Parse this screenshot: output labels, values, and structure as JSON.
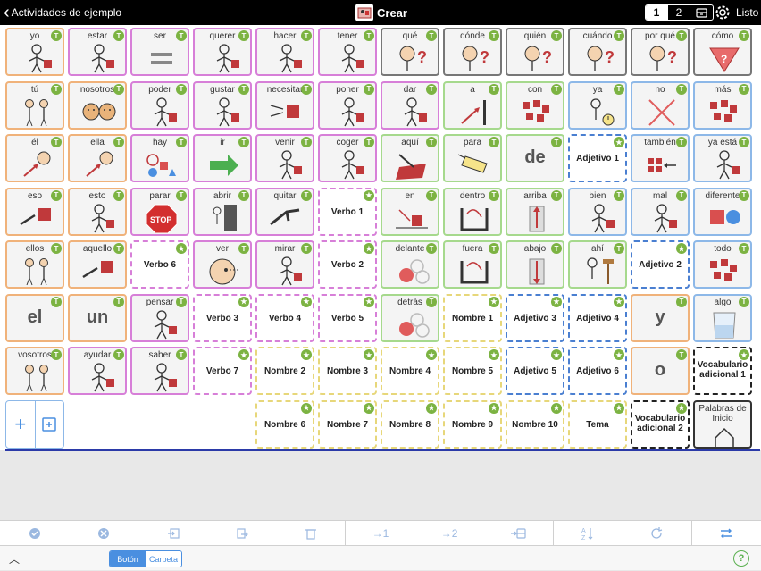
{
  "header": {
    "back_label": "Actividades de ejemplo",
    "title": "Crear",
    "pages": [
      "1",
      "2"
    ],
    "done_label": "Listo"
  },
  "cells": [
    {
      "r": 0,
      "c": 0,
      "label": "yo",
      "color": "orange",
      "icon": "person-icon"
    },
    {
      "r": 0,
      "c": 1,
      "label": "estar",
      "color": "purple",
      "icon": "person-icon"
    },
    {
      "r": 0,
      "c": 2,
      "label": "ser",
      "color": "purple",
      "icon": "equals-icon"
    },
    {
      "r": 0,
      "c": 3,
      "label": "querer",
      "color": "purple",
      "icon": "person-icon"
    },
    {
      "r": 0,
      "c": 4,
      "label": "hacer",
      "color": "purple",
      "icon": "person-icon"
    },
    {
      "r": 0,
      "c": 5,
      "label": "tener",
      "color": "purple",
      "icon": "person-icon"
    },
    {
      "r": 0,
      "c": 6,
      "label": "qué",
      "color": "gray",
      "icon": "question-icon"
    },
    {
      "r": 0,
      "c": 7,
      "label": "dónde",
      "color": "gray",
      "icon": "question-icon"
    },
    {
      "r": 0,
      "c": 8,
      "label": "quién",
      "color": "gray",
      "icon": "question-icon"
    },
    {
      "r": 0,
      "c": 9,
      "label": "cuándo",
      "color": "gray",
      "icon": "question-icon"
    },
    {
      "r": 0,
      "c": 10,
      "label": "por qué",
      "color": "gray",
      "icon": "question-icon"
    },
    {
      "r": 0,
      "c": 11,
      "label": "cómo",
      "color": "gray",
      "icon": "triangle-question-icon"
    },
    {
      "r": 1,
      "c": 0,
      "label": "tú",
      "color": "orange",
      "icon": "people-icon"
    },
    {
      "r": 1,
      "c": 1,
      "label": "nosotros",
      "color": "orange",
      "icon": "faces-icon"
    },
    {
      "r": 1,
      "c": 2,
      "label": "poder",
      "color": "purple",
      "icon": "person-icon"
    },
    {
      "r": 1,
      "c": 3,
      "label": "gustar",
      "color": "purple",
      "icon": "person-icon"
    },
    {
      "r": 1,
      "c": 4,
      "label": "necesitar",
      "color": "purple",
      "icon": "hands-box-icon"
    },
    {
      "r": 1,
      "c": 5,
      "label": "poner",
      "color": "purple",
      "icon": "person-icon"
    },
    {
      "r": 1,
      "c": 6,
      "label": "dar",
      "color": "purple",
      "icon": "person-icon"
    },
    {
      "r": 1,
      "c": 7,
      "label": "a",
      "color": "green",
      "icon": "arrow-icon"
    },
    {
      "r": 1,
      "c": 8,
      "label": "con",
      "color": "green",
      "icon": "boxes-icon"
    },
    {
      "r": 1,
      "c": 9,
      "label": "ya",
      "color": "blue",
      "icon": "person-clock-icon"
    },
    {
      "r": 1,
      "c": 10,
      "label": "no",
      "color": "blue",
      "icon": "x-icon"
    },
    {
      "r": 1,
      "c": 11,
      "label": "más",
      "color": "blue",
      "icon": "boxes-icon"
    },
    {
      "r": 2,
      "c": 0,
      "label": "él",
      "color": "orange",
      "icon": "face-arrow-icon"
    },
    {
      "r": 2,
      "c": 1,
      "label": "ella",
      "color": "orange",
      "icon": "face-arrow-icon"
    },
    {
      "r": 2,
      "c": 2,
      "label": "hay",
      "color": "purple",
      "icon": "shapes-icon"
    },
    {
      "r": 2,
      "c": 3,
      "label": "ir",
      "color": "purple",
      "icon": "green-arrow-icon"
    },
    {
      "r": 2,
      "c": 4,
      "label": "venir",
      "color": "purple",
      "icon": "person-icon"
    },
    {
      "r": 2,
      "c": 5,
      "label": "coger",
      "color": "purple",
      "icon": "person-icon"
    },
    {
      "r": 2,
      "c": 6,
      "label": "aquí",
      "color": "green",
      "icon": "point-here-icon"
    },
    {
      "r": 2,
      "c": 7,
      "label": "para",
      "color": "green",
      "icon": "tag-icon"
    },
    {
      "r": 2,
      "c": 8,
      "label": "de",
      "color": "green",
      "type": "big"
    },
    {
      "r": 2,
      "c": 9,
      "label": "Adjetivo 1",
      "color": "blueph",
      "type": "ph"
    },
    {
      "r": 2,
      "c": 10,
      "label": "también",
      "color": "blue",
      "icon": "boxes-arrow-icon"
    },
    {
      "r": 2,
      "c": 11,
      "label": "ya está",
      "color": "blue",
      "icon": "person-icon"
    },
    {
      "r": 3,
      "c": 0,
      "label": "eso",
      "color": "orange",
      "icon": "point-box-icon"
    },
    {
      "r": 3,
      "c": 1,
      "label": "esto",
      "color": "orange",
      "icon": "person-icon"
    },
    {
      "r": 3,
      "c": 2,
      "label": "parar",
      "color": "purple",
      "icon": "stop-icon"
    },
    {
      "r": 3,
      "c": 3,
      "label": "abrir",
      "color": "purple",
      "icon": "door-icon"
    },
    {
      "r": 3,
      "c": 4,
      "label": "quitar",
      "color": "purple",
      "icon": "hand-icon"
    },
    {
      "r": 3,
      "c": 5,
      "label": "Verbo 1",
      "color": "purpleph",
      "type": "ph"
    },
    {
      "r": 3,
      "c": 6,
      "label": "en",
      "color": "green",
      "icon": "in-icon"
    },
    {
      "r": 3,
      "c": 7,
      "label": "dentro",
      "color": "green",
      "icon": "container-icon"
    },
    {
      "r": 3,
      "c": 8,
      "label": "arriba",
      "color": "green",
      "icon": "up-icon"
    },
    {
      "r": 3,
      "c": 9,
      "label": "bien",
      "color": "blue",
      "icon": "person-icon"
    },
    {
      "r": 3,
      "c": 10,
      "label": "mal",
      "color": "blue",
      "icon": "person-icon"
    },
    {
      "r": 3,
      "c": 11,
      "label": "diferente",
      "color": "blue",
      "icon": "square-circle-icon"
    },
    {
      "r": 4,
      "c": 0,
      "label": "ellos",
      "color": "orange",
      "icon": "people-icon"
    },
    {
      "r": 4,
      "c": 1,
      "label": "aquello",
      "color": "orange",
      "icon": "point-box-icon"
    },
    {
      "r": 4,
      "c": 2,
      "label": "Verbo 6",
      "color": "purpleph",
      "type": "ph"
    },
    {
      "r": 4,
      "c": 3,
      "label": "ver",
      "color": "purple",
      "icon": "eye-face-icon"
    },
    {
      "r": 4,
      "c": 4,
      "label": "mirar",
      "color": "purple",
      "icon": "person-icon"
    },
    {
      "r": 4,
      "c": 5,
      "label": "Verbo 2",
      "color": "purpleph",
      "type": "ph"
    },
    {
      "r": 4,
      "c": 6,
      "label": "delante",
      "color": "green",
      "icon": "circles-icon"
    },
    {
      "r": 4,
      "c": 7,
      "label": "fuera",
      "color": "green",
      "icon": "container-icon"
    },
    {
      "r": 4,
      "c": 8,
      "label": "abajo",
      "color": "green",
      "icon": "down-icon"
    },
    {
      "r": 4,
      "c": 9,
      "label": "ahí",
      "color": "green",
      "icon": "person-sign-icon"
    },
    {
      "r": 4,
      "c": 10,
      "label": "Adjetivo 2",
      "color": "blueph",
      "type": "ph"
    },
    {
      "r": 4,
      "c": 11,
      "label": "todo",
      "color": "blue",
      "icon": "boxes-icon"
    },
    {
      "r": 5,
      "c": 0,
      "label": "el",
      "color": "orange",
      "type": "big"
    },
    {
      "r": 5,
      "c": 1,
      "label": "un",
      "color": "orange",
      "type": "big"
    },
    {
      "r": 5,
      "c": 2,
      "label": "pensar",
      "color": "purple",
      "icon": "person-icon"
    },
    {
      "r": 5,
      "c": 3,
      "label": "Verbo 3",
      "color": "purpleph",
      "type": "ph"
    },
    {
      "r": 5,
      "c": 4,
      "label": "Verbo 4",
      "color": "purpleph",
      "type": "ph"
    },
    {
      "r": 5,
      "c": 5,
      "label": "Verbo 5",
      "color": "purpleph",
      "type": "ph"
    },
    {
      "r": 5,
      "c": 6,
      "label": "detrás",
      "color": "green",
      "icon": "circles-icon"
    },
    {
      "r": 5,
      "c": 7,
      "label": "Nombre 1",
      "color": "yellowph",
      "type": "ph"
    },
    {
      "r": 5,
      "c": 8,
      "label": "Adjetivo 3",
      "color": "blueph",
      "type": "ph"
    },
    {
      "r": 5,
      "c": 9,
      "label": "Adjetivo 4",
      "color": "blueph",
      "type": "ph"
    },
    {
      "r": 5,
      "c": 10,
      "label": "y",
      "color": "orange",
      "type": "big"
    },
    {
      "r": 5,
      "c": 11,
      "label": "algo",
      "color": "blue",
      "icon": "glass-icon"
    },
    {
      "r": 6,
      "c": 0,
      "label": "vosotros",
      "color": "orange",
      "icon": "people-icon"
    },
    {
      "r": 6,
      "c": 1,
      "label": "ayudar",
      "color": "purple",
      "icon": "person-icon"
    },
    {
      "r": 6,
      "c": 2,
      "label": "saber",
      "color": "purple",
      "icon": "person-icon"
    },
    {
      "r": 6,
      "c": 3,
      "label": "Verbo 7",
      "color": "purpleph",
      "type": "ph"
    },
    {
      "r": 6,
      "c": 4,
      "label": "Nombre 2",
      "color": "yellowph",
      "type": "ph"
    },
    {
      "r": 6,
      "c": 5,
      "label": "Nombre 3",
      "color": "yellowph",
      "type": "ph"
    },
    {
      "r": 6,
      "c": 6,
      "label": "Nombre 4",
      "color": "yellowph",
      "type": "ph"
    },
    {
      "r": 6,
      "c": 7,
      "label": "Nombre 5",
      "color": "yellowph",
      "type": "ph"
    },
    {
      "r": 6,
      "c": 8,
      "label": "Adjetivo 5",
      "color": "blueph",
      "type": "ph"
    },
    {
      "r": 6,
      "c": 9,
      "label": "Adjetivo 6",
      "color": "blueph",
      "type": "ph"
    },
    {
      "r": 6,
      "c": 10,
      "label": "o",
      "color": "orange",
      "type": "big"
    },
    {
      "r": 6,
      "c": 11,
      "label": "Vocabulario adicional 1",
      "type": "vocab"
    },
    {
      "r": 7,
      "c": 4,
      "label": "Nombre 6",
      "color": "yellowph",
      "type": "ph"
    },
    {
      "r": 7,
      "c": 5,
      "label": "Nombre 7",
      "color": "yellowph",
      "type": "ph"
    },
    {
      "r": 7,
      "c": 6,
      "label": "Nombre 8",
      "color": "yellowph",
      "type": "ph"
    },
    {
      "r": 7,
      "c": 7,
      "label": "Nombre 9",
      "color": "yellowph",
      "type": "ph"
    },
    {
      "r": 7,
      "c": 8,
      "label": "Nombre 10",
      "color": "yellowph",
      "type": "ph"
    },
    {
      "r": 7,
      "c": 9,
      "label": "Tema",
      "color": "yellowph",
      "type": "ph"
    },
    {
      "r": 7,
      "c": 10,
      "label": "Vocabulario adicional 2",
      "type": "vocab"
    },
    {
      "r": 7,
      "c": 11,
      "label": "Palabras de Inicio",
      "type": "folder"
    }
  ],
  "badge_letter": "T",
  "bottom": {
    "mode_button": "Botón",
    "mode_folder": "Carpeta",
    "help": "?"
  },
  "toolbar": {
    "goto1": "→1",
    "goto2": "→2"
  }
}
